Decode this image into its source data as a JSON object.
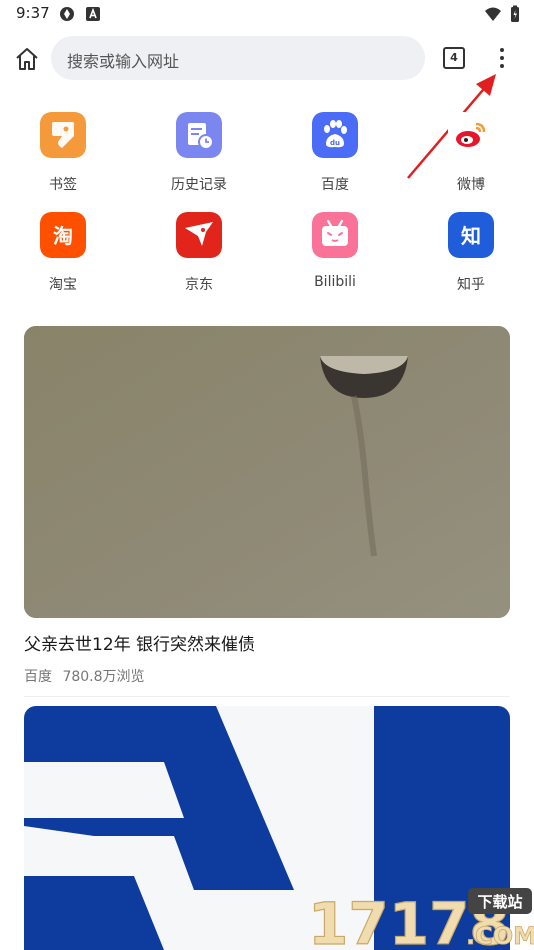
{
  "status": {
    "time": "9:37"
  },
  "search": {
    "placeholder": "搜索或输入网址"
  },
  "toolbar": {
    "tab_count": "4"
  },
  "quick_links": [
    {
      "label": "书签",
      "icon": "bookmark-icon",
      "color": "#f59a3a"
    },
    {
      "label": "历史记录",
      "icon": "history-icon",
      "color": "#7b86f0"
    },
    {
      "label": "百度",
      "icon": "baidu-icon",
      "color": "#4a6cf7"
    },
    {
      "label": "微博",
      "icon": "weibo-icon",
      "color": "#e6162d"
    },
    {
      "label": "淘宝",
      "icon": "taobao-icon",
      "color": "#ff5000"
    },
    {
      "label": "京东",
      "icon": "jd-icon",
      "color": "#e1251b"
    },
    {
      "label": "Bilibili",
      "icon": "bilibili-icon",
      "color": "#fb7299"
    },
    {
      "label": "知乎",
      "icon": "zhihu-icon",
      "color": "#1f5ddb"
    }
  ],
  "icon_glyphs": {
    "taobao": "淘",
    "zhihu": "知"
  },
  "feed": [
    {
      "title": "父亲去世12年 银行突然来催债",
      "source": "百度",
      "views": "780.8万浏览"
    }
  ],
  "watermark": {
    "digits": "17178",
    "tag": "下载站",
    "domain": ".COM"
  }
}
